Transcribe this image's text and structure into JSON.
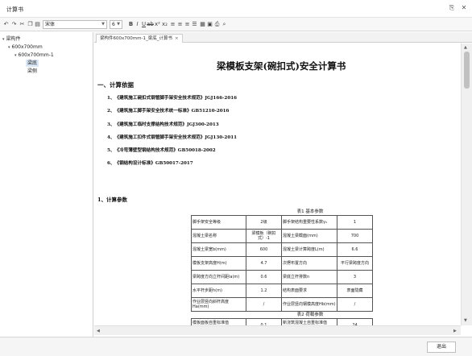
{
  "window": {
    "title": "计算书",
    "restore_glyph": "⎘",
    "close_glyph": "✕"
  },
  "toolbar": {
    "font_name": "宋体",
    "font_size": "6",
    "icons": [
      "undo-icon",
      "redo-icon",
      "cut-icon",
      "copy-icon",
      "paste-icon",
      "bold-icon",
      "italic-icon",
      "underline-icon",
      "strikethrough-icon",
      "superscript-icon",
      "subscript-icon",
      "align-left-icon",
      "align-center-icon",
      "align-right-icon",
      "justify-icon",
      "table-icon",
      "image-icon",
      "print-icon",
      "find-icon"
    ]
  },
  "tree": {
    "items": [
      {
        "label": "梁构件",
        "level": 0,
        "caret": "▾"
      },
      {
        "label": "600x700mm",
        "level": 1,
        "caret": "▾"
      },
      {
        "label": "600x700mm-1",
        "level": 2,
        "caret": "▾"
      },
      {
        "label": "梁底",
        "level": 3,
        "caret": "",
        "selected": true
      },
      {
        "label": "梁侧",
        "level": 3,
        "caret": ""
      }
    ]
  },
  "tab": {
    "label": "梁构件600x700mm-1_梁底_计算书",
    "close": "×"
  },
  "document": {
    "title": "梁模板支架(碗扣式)安全计算书",
    "section1": "一、计算依据",
    "basis": [
      "1、《建筑施工碗扣式钢管脚手架安全技术规范》JGJ166-2016",
      "2、《建筑施工脚手架安全技术统一标准》GB51210-2016",
      "3、《建筑施工临时支撑结构技术规范》JGJ300-2013",
      "4、《建筑施工扣件式钢管脚手架安全技术规范》JGJ130-2011",
      "5、《冷弯薄壁型钢结构技术规范》GB50018-2002",
      "6、《钢结构设计标准》GB50017-2017"
    ],
    "section2": "1、计算参数",
    "table1_caption": "表1 基本参数",
    "table1": [
      [
        "脚手架安全等级",
        "2级",
        "脚手架结构重要性系数γ₀",
        "1"
      ],
      [
        "混凝土梁名称",
        "梁模板（碗扣式）-1",
        "混凝土梁截面(mm)",
        "700"
      ],
      [
        "混凝土梁宽b(mm)",
        "600",
        "混凝土梁计算跨度L(m)",
        "6.6"
      ],
      [
        "模板支架高度H(m)",
        "4.7",
        "次楞布置方向",
        "平行梁跨度方向"
      ],
      [
        "梁跨度方向立杆间距la(m)",
        "0.6",
        "梁底立杆排数n",
        "3"
      ],
      [
        "水平杆步距h(m)",
        "1.2",
        "结构表面要求",
        "表面隐藏"
      ],
      [
        "作业层竖向斜杆高度Ha(mm)",
        "/",
        "作业层竖向钢模高度Hb(mm)",
        "/"
      ]
    ],
    "table2_caption": "表2 荷载参数",
    "table2": [
      [
        "模板面板自重标准值G1k(kN/m²)",
        "0.1",
        "新浇筑混凝土自重标准值G2k(kN/m³)",
        "24"
      ]
    ]
  },
  "bottom": {
    "exit_label": "退出"
  }
}
